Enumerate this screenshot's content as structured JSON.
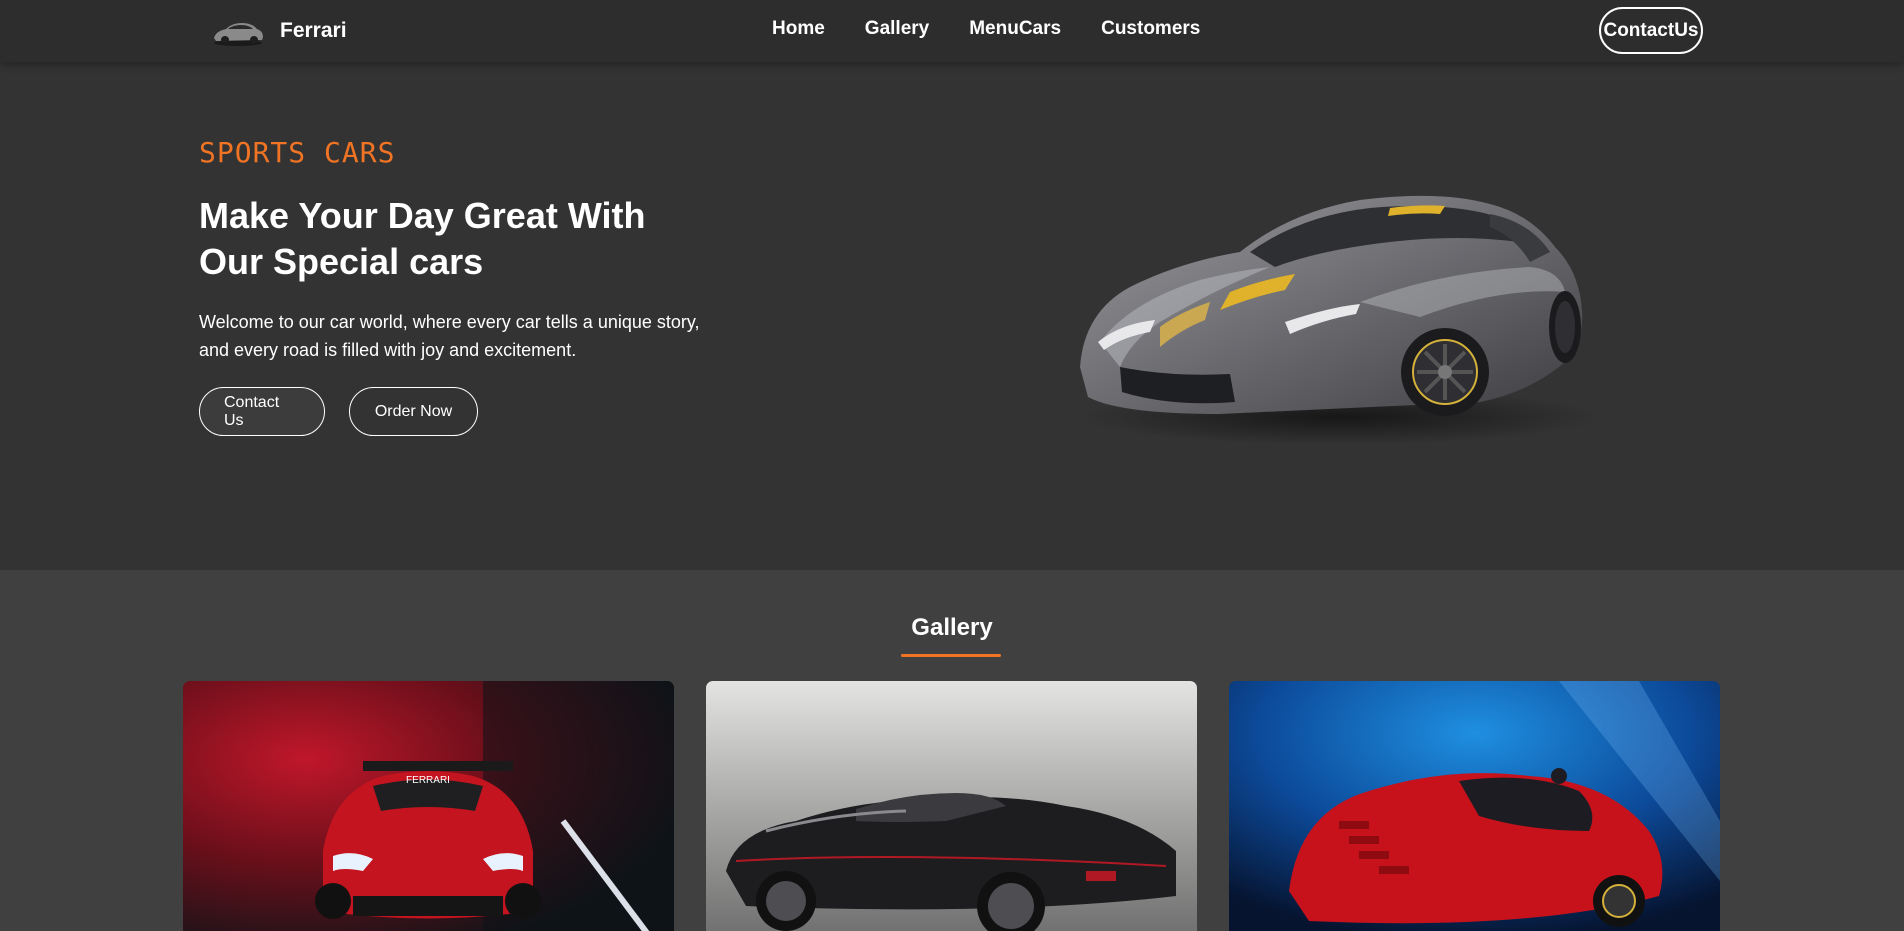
{
  "navbar": {
    "brand_name": "Ferrari",
    "brand_logo_icon": "car-logo-icon",
    "links": [
      {
        "label": "Home"
      },
      {
        "label": "Gallery"
      },
      {
        "label": "MenuCars"
      },
      {
        "label": "Customers"
      }
    ],
    "contact_label": "ContactUs"
  },
  "hero": {
    "eyebrow": "SPORTS CARS",
    "title_line1": "Make Your Day Great With",
    "title_line2": "Our Special cars",
    "text_line1": "Welcome to our car world, where every car tells a unique story,",
    "text_line2": "and every road is filled with joy and excitement.",
    "button_contact": "Contact Us",
    "button_order": "Order Now",
    "image": "grey-sports-car-image"
  },
  "gallery": {
    "title": "Gallery",
    "images": [
      "red-race-car-image",
      "black-convertible-image",
      "red-sports-car-blue-backdrop-image"
    ]
  },
  "colors": {
    "background": "#333333",
    "navbar": "#2d2d2d",
    "gallery_background": "#404040",
    "accent": "#f07424",
    "text": "#ffffff"
  }
}
